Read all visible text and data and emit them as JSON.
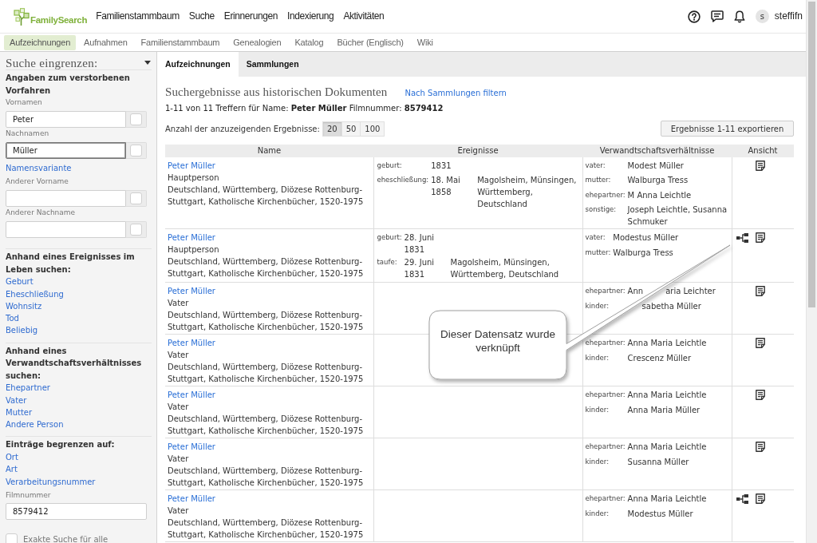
{
  "header": {
    "logo": "FamilySearch",
    "nav": [
      "Familienstammbaum",
      "Suche",
      "Erinnerungen",
      "Indexierung",
      "Aktivitäten"
    ],
    "user": {
      "initial": "s",
      "name": "steffifn"
    }
  },
  "subnav": [
    {
      "label": "Aufzeichnungen",
      "selected": true
    },
    {
      "label": "Aufnahmen",
      "selected": false
    },
    {
      "label": "Familienstammbaum",
      "selected": false
    },
    {
      "label": "Genealogien",
      "selected": false
    },
    {
      "label": "Katalog",
      "selected": false
    },
    {
      "label": "Bücher (Englisch)",
      "selected": false
    },
    {
      "label": "Wiki",
      "selected": false
    }
  ],
  "sidebar": {
    "title": "Suche eingrenzen:",
    "sections": [
      {
        "heading": "Angaben zum verstorbenen Vorfahren",
        "items": [
          {
            "kind": "name_field",
            "label": "Vornamen",
            "value": "Peter",
            "focused": false,
            "checked": false
          },
          {
            "kind": "name_field",
            "label": "Nachnamen",
            "value": "Müller",
            "focused": true,
            "checked": false
          },
          {
            "kind": "link",
            "label": "Namensvariante"
          },
          {
            "kind": "name_field",
            "label": "Anderer Vorname",
            "focused": false,
            "checked": false
          },
          {
            "kind": "name_field",
            "label": "Anderer Nachname",
            "focused": false,
            "checked": false
          }
        ]
      },
      {
        "heading": "Anhand eines Ereignisses im Leben suchen:",
        "items": [
          {
            "kind": "link",
            "label": "Geburt"
          },
          {
            "kind": "link",
            "label": "Eheschließung"
          },
          {
            "kind": "link",
            "label": "Wohnsitz"
          },
          {
            "kind": "link",
            "label": "Tod"
          },
          {
            "kind": "link",
            "label": "Beliebig"
          }
        ]
      },
      {
        "heading": "Anhand eines Verwandtschaftsverhältnisses suchen:",
        "items": [
          {
            "kind": "link",
            "label": "Ehepartner"
          },
          {
            "kind": "link",
            "label": "Vater"
          },
          {
            "kind": "link",
            "label": "Mutter"
          },
          {
            "kind": "link",
            "label": "Andere Person"
          }
        ]
      },
      {
        "heading": "Einträge begrenzen auf:",
        "items": [
          {
            "kind": "link",
            "label": "Ort"
          },
          {
            "kind": "link",
            "label": "Art"
          },
          {
            "kind": "link",
            "label": "Verarbeitungsnummer"
          },
          {
            "kind": "field",
            "label": "Filmnummer",
            "value": "8579412"
          },
          {
            "kind": "checkbox",
            "label": "Exakte Suche für alle",
            "checked": false
          }
        ]
      }
    ]
  },
  "tabs": [
    {
      "label": "Aufzeichnungen",
      "selected": true
    },
    {
      "label": "Sammlungen",
      "selected": false
    }
  ],
  "results": {
    "heading": "Suchergebnisse aus historischen Dokumenten",
    "filter_link": "Nach Sammlungen filtern",
    "summary": "1-11 von 11 Treffern für Name: **Peter Müller** Filmnummer: **8579412**",
    "page_size": {
      "label": "Anzahl der anzuzeigenden Ergebnisse:",
      "options": [
        {
          "label": "20",
          "selected": true
        },
        {
          "label": "50",
          "selected": false
        },
        {
          "label": "100",
          "selected": false
        }
      ]
    },
    "export_button": "Ergebnisse 1-11 exportieren"
  },
  "table": {
    "columns": [
      "Name",
      "Ereignisse",
      "Verwandtschaftsverhältnisse",
      "Ansicht"
    ],
    "rows": [
      {
        "name": "Peter Müller",
        "role": "Hauptperson",
        "collection": "Deutschland, Württemberg, Diözese Rottenburg-Stuttgart, Katholische Kirchenbücher, 1520-1975",
        "events": [
          {
            "type": "geburt:",
            "date": "1831"
          },
          {
            "type": "eheschließung:",
            "date": "18. Mai 1858",
            "place": "Magolsheim, Münsingen, Württemberg, Deutschland"
          }
        ],
        "relations": [
          {
            "type": "vater:",
            "name": "Modest Müller"
          },
          {
            "type": "mutter:",
            "name": "Walburga Tress"
          },
          {
            "type": "ehepartner:",
            "name": "M Anna Leichtle"
          },
          {
            "type": "sonstige:",
            "name": "Joseph Leichtle, Susanna Schmuker"
          }
        ],
        "linked": false
      },
      {
        "name": "Peter Müller",
        "role": "Hauptperson",
        "collection": "Deutschland, Württemberg, Diözese Rottenburg-Stuttgart, Katholische Kirchenbücher, 1520-1975",
        "events": [
          {
            "type": "geburt:",
            "date": "28. Juni 1831"
          },
          {
            "type": "taufe:",
            "date": "29. Juni 1831",
            "place": "Magolsheim, Münsingen, Württemberg, Deutschland"
          }
        ],
        "relations": [
          {
            "type": "vater:",
            "name": "Modestus Müller"
          },
          {
            "type": "mutter:",
            "name": "Walburga Tress"
          }
        ],
        "linked": true
      },
      {
        "name": "Peter Müller",
        "role": "Vater",
        "collection": "Deutschland, Württemberg, Diözese Rottenburg-Stuttgart, Katholische Kirchenbücher, 1520-1975",
        "relations": [
          {
            "type": "ehepartner:",
            "fragments": [
              {
                "text": "Ann",
                "hidden_before": false
              },
              {
                "text": "aria Leichter",
                "hidden_before": true
              }
            ]
          },
          {
            "type": "kinder:",
            "fragments": [
              {
                "text": "sabetha Müller",
                "hidden_before": true
              }
            ]
          }
        ],
        "linked": false
      },
      {
        "name": "Peter Müller",
        "role": "Vater",
        "collection": "Deutschland, Württemberg, Diözese Rottenburg-Stuttgart, Katholische Kirchenbücher, 1520-1975",
        "relations": [
          {
            "type": "ehepartner:",
            "name": "Anna Maria Leichtle"
          },
          {
            "type": "kinder:",
            "name": "Crescenz Müller"
          }
        ],
        "linked": false
      },
      {
        "name": "Peter Müller",
        "role": "Vater",
        "collection": "Deutschland, Württemberg, Diözese Rottenburg-Stuttgart, Katholische Kirchenbücher, 1520-1975",
        "relations": [
          {
            "type": "ehepartner:",
            "name": "Anna Maria Leichtle"
          },
          {
            "type": "kinder:",
            "name": "Anna Maria Müller"
          }
        ],
        "linked": false
      },
      {
        "name": "Peter Müller",
        "role": "Vater",
        "collection": "Deutschland, Württemberg, Diözese Rottenburg-Stuttgart, Katholische Kirchenbücher, 1520-1975",
        "relations": [
          {
            "type": "ehepartner:",
            "name": "Anna Maria Leichtle"
          },
          {
            "type": "kinder:",
            "name": "Susanna Müller"
          }
        ],
        "linked": false
      },
      {
        "name": "Peter Müller",
        "role": "Vater",
        "collection": "Deutschland, Württemberg, Diözese Rottenburg-Stuttgart, Katholische Kirchenbücher, 1520-1975",
        "relations": [
          {
            "type": "ehepartner:",
            "name": "Anna Maria Leichtle"
          },
          {
            "type": "kinder:",
            "name": "Modestus Müller"
          }
        ],
        "linked": true
      }
    ]
  },
  "callout": {
    "text": "Dieser Datensatz wurde verknüpft"
  }
}
